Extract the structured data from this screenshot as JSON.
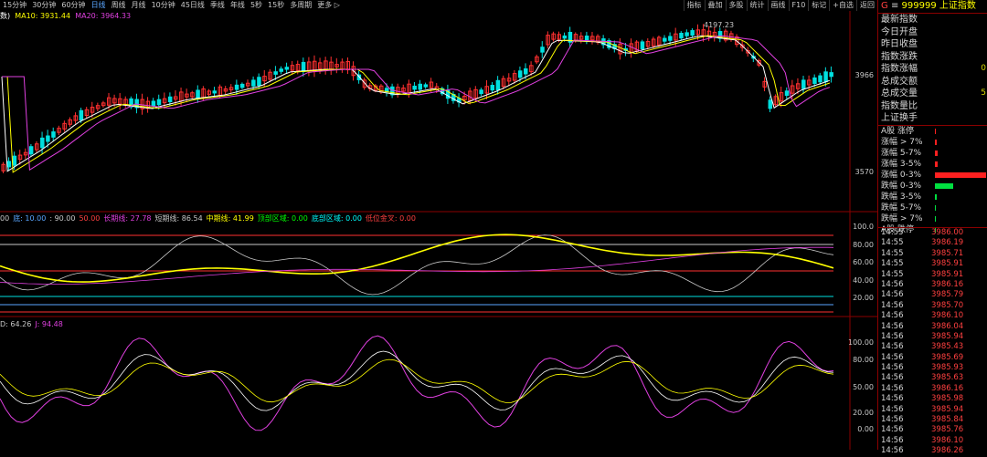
{
  "periods": [
    "15分钟",
    "30分钟",
    "60分钟",
    "日线",
    "周线",
    "月线",
    "10分钟",
    "45日线",
    "季线",
    "年线",
    "5秒",
    "15秒",
    "多周期",
    "更多 ▷"
  ],
  "active_period": "日线",
  "toolbar": [
    "指标",
    "叠加",
    "多股",
    "统计",
    "画线",
    "F10",
    "标记",
    "+自选",
    "返回"
  ],
  "ma_labels": {
    "ma5": "数)",
    "ma10": "MA10: 3931.44",
    "ma20": "MA20: 3964.33"
  },
  "price_axis": [
    "3966",
    "3570"
  ],
  "peak_label": "4197.23",
  "ind1_labels": [
    {
      "text": "00",
      "color": "#c8c8c8"
    },
    {
      "text": "底: 10.00",
      "color": "#5aa6ff"
    },
    {
      "text": ": 90.00",
      "color": "#c8c8c8"
    },
    {
      "text": "50.00",
      "color": "#ff4040"
    },
    {
      "text": "长期线: 27.78",
      "color": "#e040e0"
    },
    {
      "text": "短期线: 86.54",
      "color": "#c8c8c8"
    },
    {
      "text": "中期线: 41.99",
      "color": "#ffff00"
    },
    {
      "text": "顶部区域: 0.00",
      "color": "#00ff00"
    },
    {
      "text": "底部区域: 0.00",
      "color": "#00ffff"
    },
    {
      "text": "低位金叉: 0.00",
      "color": "#ff4040"
    }
  ],
  "ind1_axis": [
    "100.0",
    "80.00",
    "60.00",
    "40.00",
    "20.00"
  ],
  "ind2_labels": [
    {
      "text": "D: 64.26",
      "color": "#c8c8c8"
    },
    {
      "text": "J: 94.48",
      "color": "#e040e0"
    }
  ],
  "ind2_axis": [
    "100.00",
    "80.00",
    "50.00",
    "20.00",
    "0.00"
  ],
  "sidebar": {
    "title_prefix": "G",
    "title_code": "999999",
    "title_name": "上证指数",
    "rows": [
      "最新指数",
      "今日开盘",
      "昨日收盘",
      "指数涨跌",
      "指数涨幅",
      "总成交额",
      "总成交量",
      "指数量比",
      "上证换手"
    ],
    "side_values": [
      "0",
      "5"
    ],
    "distribution": [
      {
        "label": "A股 涨停",
        "bar": 0.02,
        "color": "#ff2020"
      },
      {
        "label": "涨幅 > 7%",
        "bar": 0.03,
        "color": "#ff2020"
      },
      {
        "label": "涨幅 5-7%",
        "bar": 0.05,
        "color": "#ff2020"
      },
      {
        "label": "涨幅 3-5%",
        "bar": 0.06,
        "color": "#ff2020"
      },
      {
        "label": "涨幅 0-3%",
        "bar": 1.0,
        "color": "#ff2020"
      },
      {
        "label": "跌幅 0-3%",
        "bar": 0.36,
        "color": "#00e040"
      },
      {
        "label": "跌幅 3-5%",
        "bar": 0.03,
        "color": "#00e040"
      },
      {
        "label": "跌幅 5-7%",
        "bar": 0.01,
        "color": "#00e040"
      },
      {
        "label": "跌幅 > 7%",
        "bar": 0.01,
        "color": "#00e040"
      },
      {
        "label": "A股 跌停",
        "bar": 0.01,
        "color": "#00e040"
      }
    ],
    "ticks": [
      {
        "time": "14:55",
        "price": "3986.00"
      },
      {
        "time": "14:55",
        "price": "3986.19"
      },
      {
        "time": "14:55",
        "price": "3985.71"
      },
      {
        "time": "14:55",
        "price": "3985.91"
      },
      {
        "time": "14:55",
        "price": "3985.91"
      },
      {
        "time": "14:56",
        "price": "3986.16"
      },
      {
        "time": "14:56",
        "price": "3985.79"
      },
      {
        "time": "14:56",
        "price": "3985.70"
      },
      {
        "time": "14:56",
        "price": "3986.10"
      },
      {
        "time": "14:56",
        "price": "3986.04"
      },
      {
        "time": "14:56",
        "price": "3985.94"
      },
      {
        "time": "14:56",
        "price": "3985.43"
      },
      {
        "time": "14:56",
        "price": "3985.69"
      },
      {
        "time": "14:56",
        "price": "3985.93"
      },
      {
        "time": "14:56",
        "price": "3985.63"
      },
      {
        "time": "14:56",
        "price": "3986.16"
      },
      {
        "time": "14:56",
        "price": "3985.98"
      },
      {
        "time": "14:56",
        "price": "3985.94"
      },
      {
        "time": "14:56",
        "price": "3985.84"
      },
      {
        "time": "14:56",
        "price": "3985.76"
      },
      {
        "time": "14:56",
        "price": "3986.10"
      },
      {
        "time": "14:56",
        "price": "3986.26"
      }
    ]
  },
  "colors": {
    "up": "#ff3030",
    "down": "#00e0e0",
    "ma5": "#ffffff",
    "ma10": "#ffff00",
    "ma20": "#e040e0",
    "border": "#8b0000"
  }
}
